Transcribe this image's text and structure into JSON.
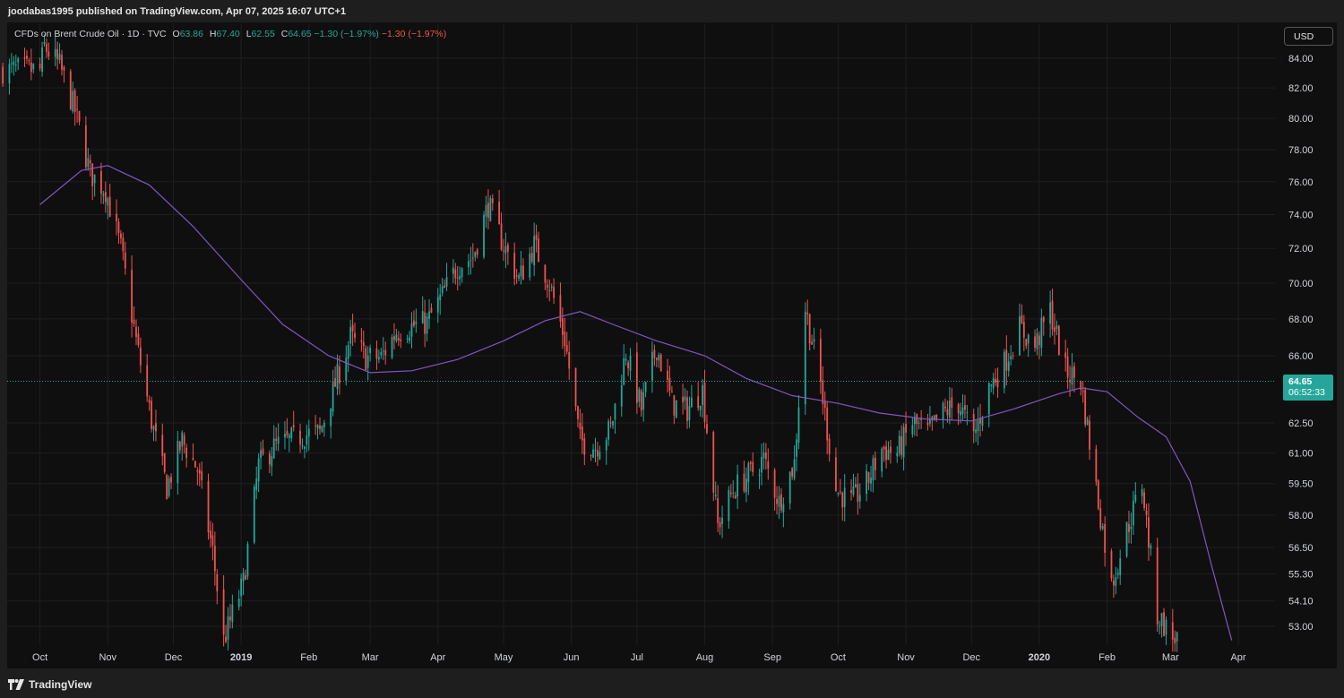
{
  "header": {
    "published": "joodabas1995 published on TradingView.com, Apr 07, 2025 16:07 UTC+1"
  },
  "legend": {
    "title": "CFDs on Brent Crude Oil · 1D · TVC",
    "open_label": "O",
    "open": "63.86",
    "high_label": "H",
    "high": "67.40",
    "low_label": "L",
    "low": "62.55",
    "close_label": "C",
    "close": "64.65",
    "change": "−1.30 (−1.97%)",
    "change2": "−1.30 (−1.97%)"
  },
  "currency_button": "USD",
  "price_badge": {
    "price": "64.65",
    "countdown": "06:52:33"
  },
  "footer": {
    "brand": "TradingView"
  },
  "colors": {
    "up": "#26a69a",
    "down": "#ef5350",
    "ma": "#7e57c2",
    "background": "#0f0f0f",
    "grid": "#1f1f1f"
  },
  "chart_data": {
    "type": "candlestick",
    "instrument": "CFDs on Brent Crude Oil",
    "interval": "1D",
    "y_scale": "log",
    "ylim": [
      52.3,
      85.5
    ],
    "y_ticks": [
      84.0,
      82.0,
      80.0,
      78.0,
      76.0,
      74.0,
      72.0,
      70.0,
      68.0,
      66.0,
      64.65,
      62.5,
      61.0,
      59.5,
      58.0,
      56.5,
      55.3,
      54.1,
      53.0
    ],
    "y_tick_labels": [
      "84.00",
      "82.00",
      "80.00",
      "78.00",
      "76.00",
      "74.00",
      "72.00",
      "70.00",
      "68.00",
      "66.00",
      "",
      "62.50",
      "61.00",
      "59.50",
      "58.00",
      "56.50",
      "55.30",
      "54.10",
      "53.00"
    ],
    "x_labels": [
      "Oct",
      "Nov",
      "Dec",
      "2019",
      "Feb",
      "Mar",
      "Apr",
      "May",
      "Jun",
      "Jul",
      "Aug",
      "Sep",
      "Oct",
      "Nov",
      "Dec",
      "2020",
      "Feb",
      "Mar",
      "Apr"
    ],
    "x_label_bold": [
      false,
      false,
      false,
      true,
      false,
      false,
      false,
      false,
      false,
      false,
      false,
      false,
      false,
      false,
      false,
      true,
      false,
      false,
      false
    ],
    "current_price": 64.65,
    "series": [
      {
        "name": "close_path",
        "dates": [
          "2018-10-01",
          "2018-10-03",
          "2018-10-10",
          "2018-10-17",
          "2018-10-24",
          "2018-10-31",
          "2018-11-07",
          "2018-11-14",
          "2018-11-21",
          "2018-11-28",
          "2018-12-05",
          "2018-12-12",
          "2018-12-19",
          "2018-12-24",
          "2019-01-02",
          "2019-01-09",
          "2019-01-16",
          "2019-01-23",
          "2019-01-30",
          "2019-02-06",
          "2019-02-13",
          "2019-02-20",
          "2019-02-27",
          "2019-03-06",
          "2019-03-13",
          "2019-03-20",
          "2019-03-27",
          "2019-04-03",
          "2019-04-10",
          "2019-04-17",
          "2019-04-24",
          "2019-05-01",
          "2019-05-08",
          "2019-05-15",
          "2019-05-22",
          "2019-05-29",
          "2019-06-05",
          "2019-06-12",
          "2019-06-19",
          "2019-06-26",
          "2019-07-03",
          "2019-07-10",
          "2019-07-17",
          "2019-07-24",
          "2019-07-31",
          "2019-08-07",
          "2019-08-14",
          "2019-08-21",
          "2019-08-28",
          "2019-09-04",
          "2019-09-11",
          "2019-09-16",
          "2019-09-23",
          "2019-09-30",
          "2019-10-07",
          "2019-10-14",
          "2019-10-21",
          "2019-10-28",
          "2019-11-04",
          "2019-11-11",
          "2019-11-18",
          "2019-11-25",
          "2019-12-02",
          "2019-12-09",
          "2019-12-16",
          "2019-12-23",
          "2019-12-30",
          "2020-01-06",
          "2020-01-13",
          "2020-01-20",
          "2020-01-27",
          "2020-02-03",
          "2020-02-10",
          "2020-02-17",
          "2020-02-24",
          "2020-03-02"
        ],
        "values": [
          83.2,
          84.8,
          83.5,
          80.5,
          76.5,
          75.5,
          72.0,
          66.8,
          62.6,
          59.3,
          61.6,
          60.2,
          56.3,
          52.4,
          54.9,
          60.4,
          61.3,
          61.6,
          61.9,
          62.0,
          64.5,
          67.0,
          65.9,
          65.9,
          67.3,
          67.6,
          67.8,
          69.3,
          71.0,
          71.5,
          74.6,
          72.2,
          70.2,
          72.2,
          70.0,
          66.9,
          61.6,
          61.3,
          62.2,
          66.2,
          63.2,
          66.5,
          63.5,
          63.2,
          64.2,
          57.5,
          59.2,
          59.9,
          60.7,
          58.6,
          60.5,
          68.6,
          64.5,
          59.2,
          58.6,
          59.5,
          61.2,
          61.0,
          62.5,
          62.0,
          63.0,
          63.5,
          61.8,
          64.3,
          65.6,
          67.5,
          66.5,
          68.5,
          65.2,
          64.6,
          59.3,
          54.8,
          57.3,
          59.5,
          53.5,
          52.5
        ]
      },
      {
        "name": "moving_average",
        "dates": [
          "2018-10-01",
          "2018-10-20",
          "2018-11-01",
          "2018-11-20",
          "2018-12-10",
          "2019-01-01",
          "2019-01-20",
          "2019-02-10",
          "2019-03-01",
          "2019-03-20",
          "2019-04-10",
          "2019-05-01",
          "2019-05-20",
          "2019-06-05",
          "2019-06-20",
          "2019-07-10",
          "2019-08-01",
          "2019-08-20",
          "2019-09-10",
          "2019-10-01",
          "2019-10-20",
          "2019-11-10",
          "2019-12-01",
          "2019-12-20",
          "2020-01-10",
          "2020-01-20",
          "2020-02-01",
          "2020-02-15",
          "2020-02-28",
          "2020-03-10",
          "2020-03-20",
          "2020-03-29"
        ],
        "values": [
          74.6,
          76.7,
          77.0,
          75.8,
          73.3,
          70.2,
          67.7,
          66.0,
          65.1,
          65.2,
          65.8,
          66.8,
          67.9,
          68.4,
          67.7,
          66.8,
          66.0,
          64.8,
          63.9,
          63.5,
          63.0,
          62.7,
          62.6,
          63.2,
          64.0,
          64.3,
          64.1,
          62.8,
          61.8,
          59.6,
          55.6,
          52.4
        ]
      }
    ]
  }
}
